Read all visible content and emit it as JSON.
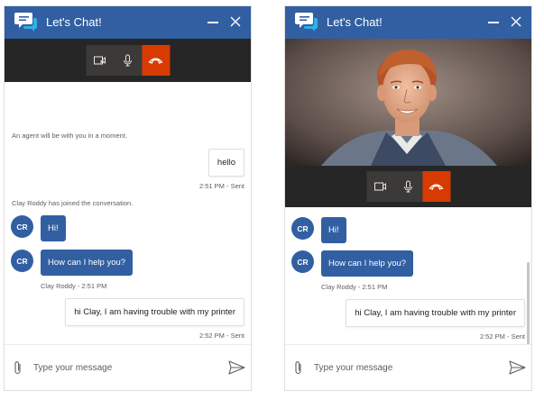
{
  "colors": {
    "header_blue": "#315fa2",
    "call_bar": "#262626",
    "control_bg": "#3b3a39",
    "end_call_red": "#d83b01",
    "agent_bubble": "#315fa2"
  },
  "left_window": {
    "header": {
      "title": "Let's Chat!",
      "logo_icon": "chat-bubbles-icon",
      "minimize_icon": "minimize-icon",
      "close_icon": "close-icon"
    },
    "call_controls": {
      "video_icon": "video-off-icon",
      "mic_icon": "microphone-icon",
      "end_icon": "end-call-icon"
    },
    "messages": {
      "system_wait": "An agent will be with you in a moment.",
      "user_hello": "hello",
      "user_hello_meta": "2:51 PM - Sent",
      "system_joined": "Clay Roddy has joined the conversation.",
      "agent_initials": "CR",
      "agent_hi": "Hi!",
      "agent_help": "How can I help you?",
      "agent_meta": "Clay Roddy - 2:51 PM",
      "user_trouble": "hi Clay, I am having trouble with my printer",
      "user_trouble_meta": "2:52 PM - Sent"
    },
    "composer": {
      "placeholder": "Type your message",
      "attach_icon": "paperclip-icon",
      "send_icon": "send-icon"
    }
  },
  "right_window": {
    "header": {
      "title": "Let's Chat!",
      "logo_icon": "chat-bubbles-icon",
      "minimize_icon": "minimize-icon",
      "close_icon": "close-icon"
    },
    "video": {
      "content": "agent-video-feed"
    },
    "call_controls": {
      "video_icon": "video-camera-icon",
      "mic_icon": "microphone-icon",
      "end_icon": "end-call-icon"
    },
    "messages": {
      "agent_initials": "CR",
      "agent_hi": "Hi!",
      "agent_help": "How can I help you?",
      "agent_meta": "Clay Roddy - 2:51 PM",
      "user_trouble": "hi Clay, I am having trouble with my printer",
      "user_trouble_meta": "2:52 PM - Sent"
    },
    "composer": {
      "placeholder": "Type your message",
      "attach_icon": "paperclip-icon",
      "send_icon": "send-icon"
    }
  }
}
